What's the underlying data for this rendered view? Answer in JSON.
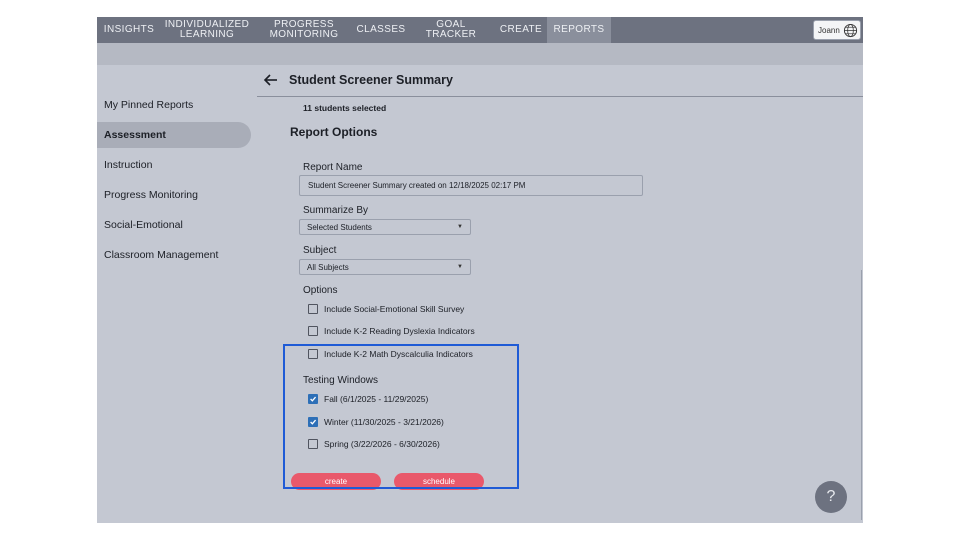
{
  "nav": {
    "items": [
      {
        "label": "INSIGHTS"
      },
      {
        "label": "INDIVIDUALIZED LEARNING"
      },
      {
        "label": "PROGRESS MONITORING"
      },
      {
        "label": "CLASSES"
      },
      {
        "label": "GOAL TRACKER"
      },
      {
        "label": "CREATE"
      },
      {
        "label": "REPORTS"
      }
    ],
    "active": "REPORTS",
    "user_name": "Joann"
  },
  "sidebar": {
    "items": [
      {
        "label": "My Pinned Reports"
      },
      {
        "label": "Assessment"
      },
      {
        "label": "Instruction"
      },
      {
        "label": "Progress Monitoring"
      },
      {
        "label": "Social-Emotional"
      },
      {
        "label": "Classroom Management"
      }
    ],
    "active": "Assessment"
  },
  "main": {
    "title": "Student Screener Summary",
    "selected_count": "11 students selected",
    "section_title": "Report Options",
    "report_name": {
      "label": "Report Name",
      "value": "Student Screener Summary created on 12/18/2025 02:17 PM"
    },
    "summarize_by": {
      "label": "Summarize By",
      "value": "Selected Students"
    },
    "subject": {
      "label": "Subject",
      "value": "All Subjects"
    },
    "options": {
      "label": "Options",
      "items": [
        {
          "label": "Include Social-Emotional Skill Survey",
          "checked": false
        },
        {
          "label": "Include K-2 Reading Dyslexia Indicators",
          "checked": false
        },
        {
          "label": "Include K-2 Math Dyscalculia Indicators",
          "checked": false
        }
      ]
    },
    "testing_windows": {
      "label": "Testing Windows",
      "items": [
        {
          "label": "Fall (6/1/2025 - 11/29/2025)",
          "checked": true
        },
        {
          "label": "Winter (11/30/2025 - 3/21/2026)",
          "checked": true
        },
        {
          "label": "Spring (3/22/2026 - 6/30/2026)",
          "checked": false
        }
      ]
    },
    "buttons": {
      "create": "create",
      "schedule": "schedule"
    },
    "help": "?"
  },
  "colors": {
    "nav_bg": "#6d7280",
    "panel_bg": "#c4c8d2",
    "accent_pink": "#e9596b",
    "checkbox_blue": "#2d6fb7",
    "highlight_blue": "#1f5bd6"
  }
}
